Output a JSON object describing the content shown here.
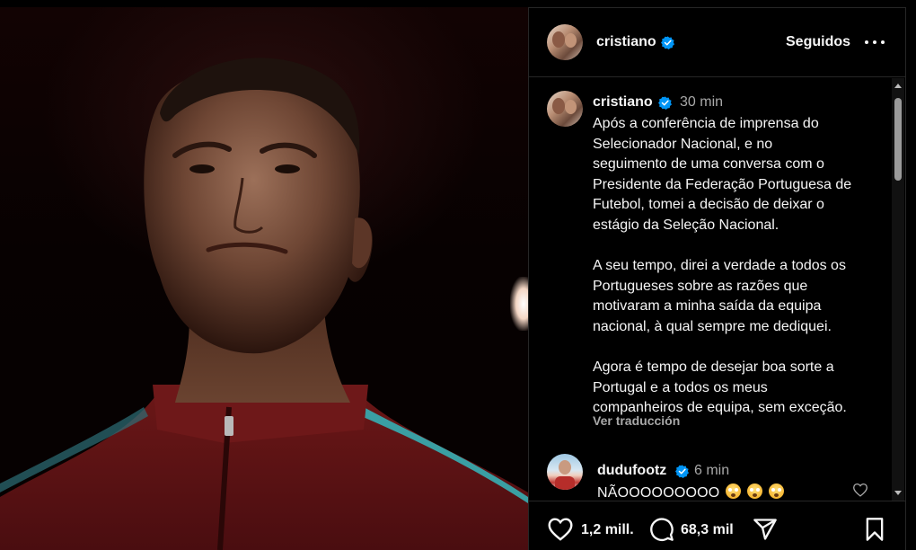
{
  "post": {
    "author": "cristiano",
    "follow_state": "Seguidos",
    "verified": true
  },
  "caption": {
    "username": "cristiano",
    "time": "30 min",
    "paragraphs": [
      [
        "Após a conferência de imprensa do",
        "Selecionador Nacional, e no",
        "seguimento de uma conversa com o",
        "Presidente da Federação Portuguesa de",
        "Futebol, tomei a decisão de deixar o",
        "estágio da Seleção Nacional."
      ],
      [
        "A seu tempo, direi a verdade a todos os",
        "Portugueses sobre as razões que",
        "motivaram a minha saída da equipa",
        "nacional, à qual sempre me dediquei."
      ],
      [
        "Agora é tempo de desejar boa sorte a",
        "Portugal e a todos os meus",
        "companheiros de equipa, sem exceção."
      ]
    ],
    "see_translation": "Ver traducción"
  },
  "comment": {
    "username": "dudufootz",
    "time": "6 min",
    "text": "NÃOOOOOOOOO",
    "emojis": [
      "flushed-face-emoji",
      "flushed-face-emoji",
      "flushed-face-emoji"
    ]
  },
  "actions": {
    "likes": "1,2 mill.",
    "comments": "68,3 mil"
  },
  "colors": {
    "background": "#000000",
    "text": "#f5f5f5",
    "secondary_text": "#a8a8a8",
    "verified_badge": "#0095f6",
    "divider": "#262626"
  }
}
